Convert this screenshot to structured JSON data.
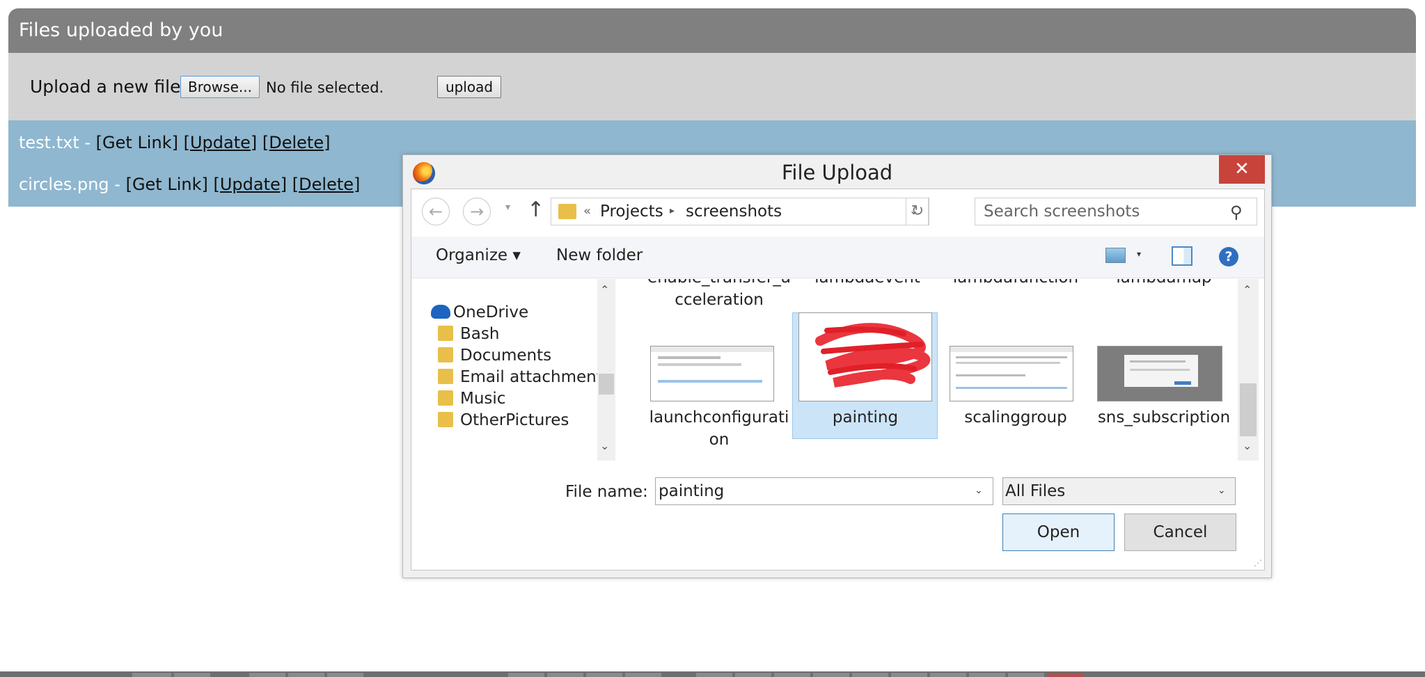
{
  "page": {
    "header_title": "Files uploaded by you",
    "upload_label": "Upload a new file :",
    "browse_label": "Browse...",
    "no_file_text": "No file selected.",
    "upload_button": "upload",
    "files": [
      {
        "name": "test.txt",
        "sep": " - ",
        "get_link": "[Get Link]",
        "update": "[Update]",
        "delete": "[Delete]"
      },
      {
        "name": "circles.png",
        "sep": " - ",
        "get_link": "[Get Link]",
        "update": "[Update]",
        "delete": "[Delete]"
      }
    ]
  },
  "dialog": {
    "title": "File Upload",
    "close_glyph": "✕",
    "back_glyph": "←",
    "forward_glyph": "→",
    "recent_glyph": "▾",
    "up_glyph": "↑",
    "address": {
      "chevron": "«",
      "crumbs": [
        "Projects",
        "screenshots"
      ],
      "separator": "▸",
      "dropdown": "⌄"
    },
    "refresh_glyph": "↻",
    "search_placeholder": "Search screenshots",
    "search_glyph": "⚲",
    "toolbar": {
      "organize": "Organize ▾",
      "new_folder": "New folder",
      "view_dd": "▾",
      "help": "?"
    },
    "nav_items": [
      {
        "label": "OneDrive",
        "icon": "cloud-icon"
      },
      {
        "label": "Bash",
        "icon": "folder-icon"
      },
      {
        "label": "Documents",
        "icon": "folder-icon"
      },
      {
        "label": "Email attachments",
        "icon": "folder-icon"
      },
      {
        "label": "Music",
        "icon": "folder-icon"
      },
      {
        "label": "OtherPictures",
        "icon": "folder-icon"
      }
    ],
    "scroll_up": "⌃",
    "scroll_down": "⌄",
    "top_row_labels": [
      "enable_transfer_a cceleration",
      "lambdaevent",
      "lambdafunction",
      "lambdamap"
    ],
    "tiles": [
      {
        "label": "launchconfigurati on",
        "selected": false
      },
      {
        "label": "painting",
        "selected": true
      },
      {
        "label": "scalinggroup",
        "selected": false
      },
      {
        "label": "sns_subscription",
        "selected": false
      }
    ],
    "file_name_label": "File name:",
    "file_name_value": "painting",
    "filter_value": "All Files",
    "dropdown_glyph": "⌄",
    "open_button": "Open",
    "cancel_button": "Cancel",
    "grip": "⋰"
  },
  "colors": {
    "header": "#808080",
    "upload_bar": "#d3d3d3",
    "file_list": "#8fb7cf",
    "close": "#c8443b",
    "selection": "#cce4f7"
  }
}
